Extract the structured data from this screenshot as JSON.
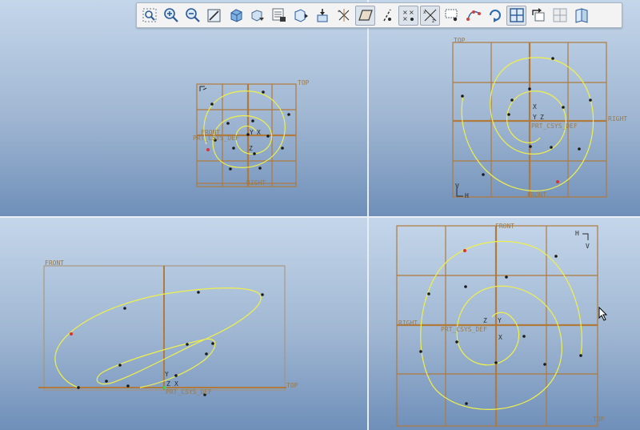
{
  "toolbar": {
    "buttons": [
      {
        "icon": "refit-icon",
        "tooltip": "Refit"
      },
      {
        "icon": "zoom-in-icon",
        "tooltip": "Zoom In"
      },
      {
        "icon": "zoom-out-icon",
        "tooltip": "Zoom Out"
      },
      {
        "icon": "repaint-icon",
        "tooltip": "Repaint"
      },
      {
        "icon": "display-style-icon",
        "tooltip": "Display Style"
      },
      {
        "icon": "saved-orientations-icon",
        "tooltip": "Saved Orientations"
      },
      {
        "icon": "view-manager-icon",
        "tooltip": "View Manager"
      },
      {
        "icon": "perspective-view-icon",
        "tooltip": "Perspective View"
      },
      {
        "icon": "annotation-display-icon",
        "tooltip": "Annotation Display"
      },
      {
        "icon": "datum-display-icon",
        "tooltip": "Datum Display Filters"
      },
      {
        "icon": "plane-display-icon",
        "tooltip": "Plane Display",
        "active": true
      },
      {
        "icon": "axis-display-icon",
        "tooltip": "Axis Display"
      },
      {
        "icon": "point-display-icon",
        "tooltip": "Point Display",
        "active": true
      },
      {
        "icon": "csys-display-icon",
        "tooltip": "Csys Display",
        "active": true
      },
      {
        "icon": "sketch-display-icon",
        "tooltip": "Sketch Display"
      },
      {
        "icon": "spline-points-icon",
        "tooltip": "Spline Points"
      },
      {
        "icon": "spin-center-icon",
        "tooltip": "Spin Center"
      },
      {
        "icon": "four-views-icon",
        "tooltip": "Four Views",
        "active": true
      },
      {
        "icon": "next-view-icon",
        "tooltip": "Next View"
      },
      {
        "icon": "view-layout-icon",
        "tooltip": "View Layout"
      },
      {
        "icon": "single-view-icon",
        "tooltip": "Single View"
      }
    ]
  },
  "viewports": {
    "top_left": {
      "labels": {
        "top": "TOP",
        "front": "FRONT",
        "right": "RIGHT",
        "csys": "PRT_CSYS_DEF"
      },
      "axes": {
        "x": "X",
        "y": "Y",
        "z": "Z"
      }
    },
    "top_right": {
      "labels": {
        "top": "TOP",
        "right": "RIGHT",
        "front": "FRONT",
        "csys": "PRT_CSYS_DEF"
      },
      "axes": {
        "x": "X",
        "y": "Y",
        "z": "Z"
      },
      "triad": {
        "v": "V",
        "h": "H"
      }
    },
    "bottom_left": {
      "labels": {
        "front": "FRONT",
        "top": "TOP",
        "csys": "PRT_CSYS_DEF"
      },
      "axes": {
        "x": "X",
        "y": "Y",
        "z": "Z"
      }
    },
    "bottom_right": {
      "labels": {
        "front": "FRONT",
        "right": "RIGHT",
        "top": "TOP",
        "csys": "PRT_CSYS_DEF"
      },
      "axes": {
        "x": "X",
        "y": "Y",
        "z": "Z"
      },
      "triad": {
        "h": "H",
        "v": "V"
      }
    }
  },
  "colors": {
    "datum_plane": "#b07a3c",
    "curve": "#f0f04a",
    "point": "#1a1a1a",
    "selected_point": "#e03030"
  }
}
